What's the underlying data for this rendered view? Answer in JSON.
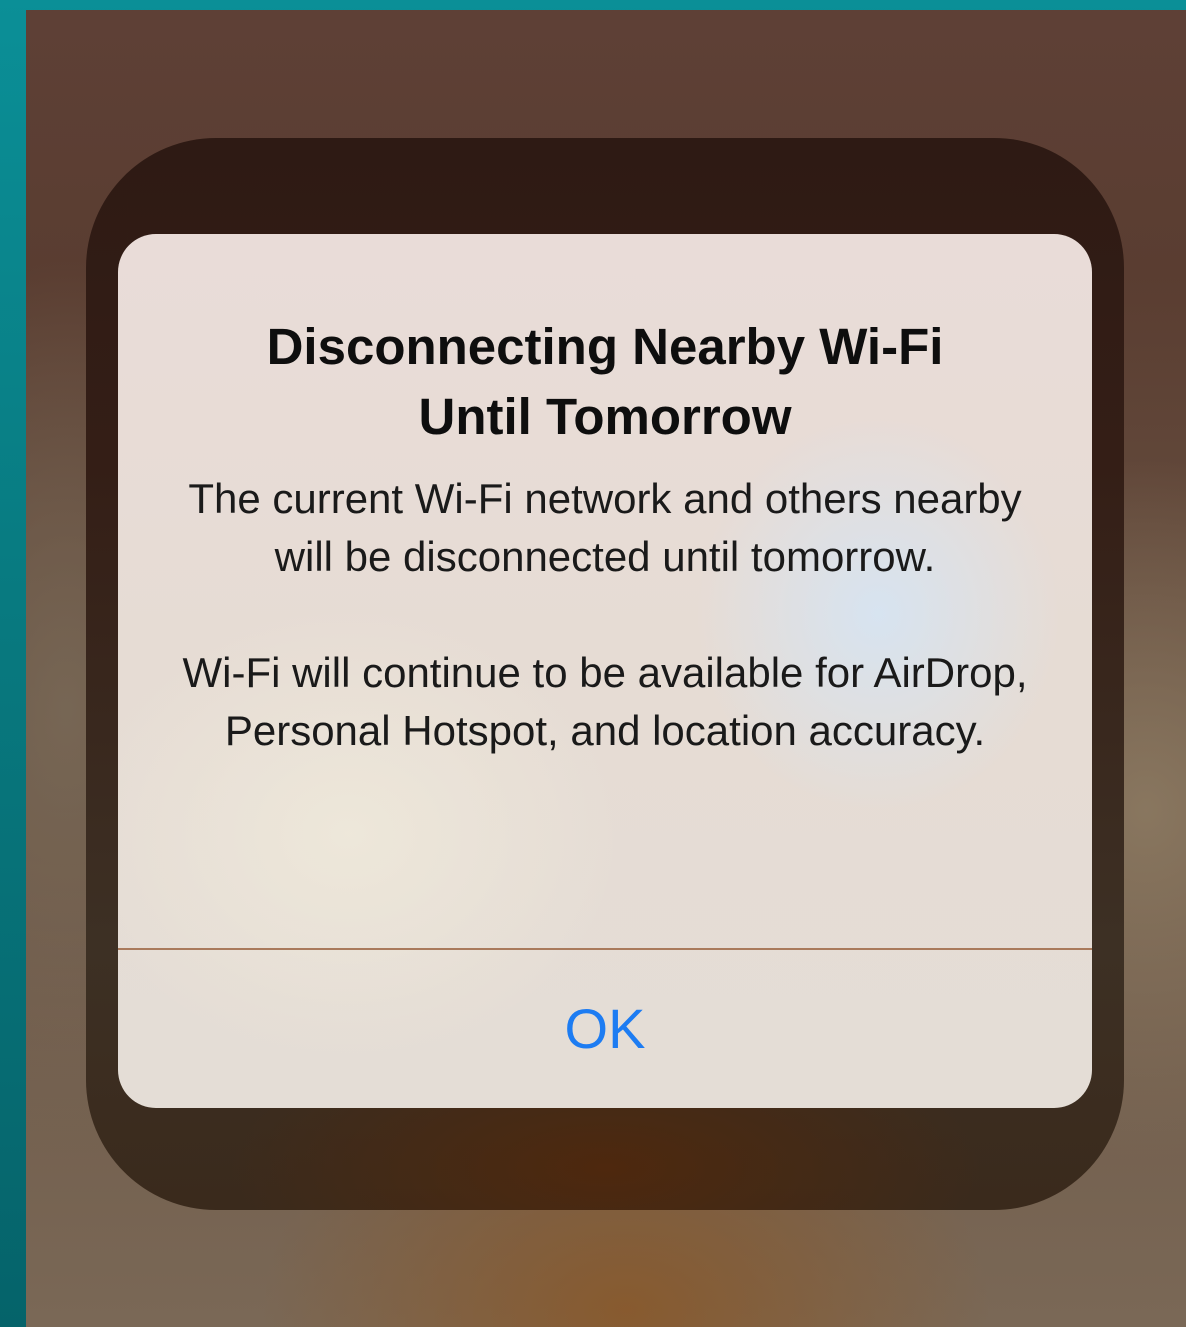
{
  "alert": {
    "title_line1": "Disconnecting Nearby Wi-Fi",
    "title_line2": "Until Tomorrow",
    "message_paragraph1": "The current Wi-Fi network and others nearby will be disconnected until tomorrow.",
    "message_paragraph2": "Wi-Fi will continue to be available for AirDrop, Personal Hotspot, and location accuracy.",
    "ok_label": "OK"
  },
  "colors": {
    "action_blue": "#1d7cf2",
    "outer_border_teal": "#0b8f97"
  }
}
